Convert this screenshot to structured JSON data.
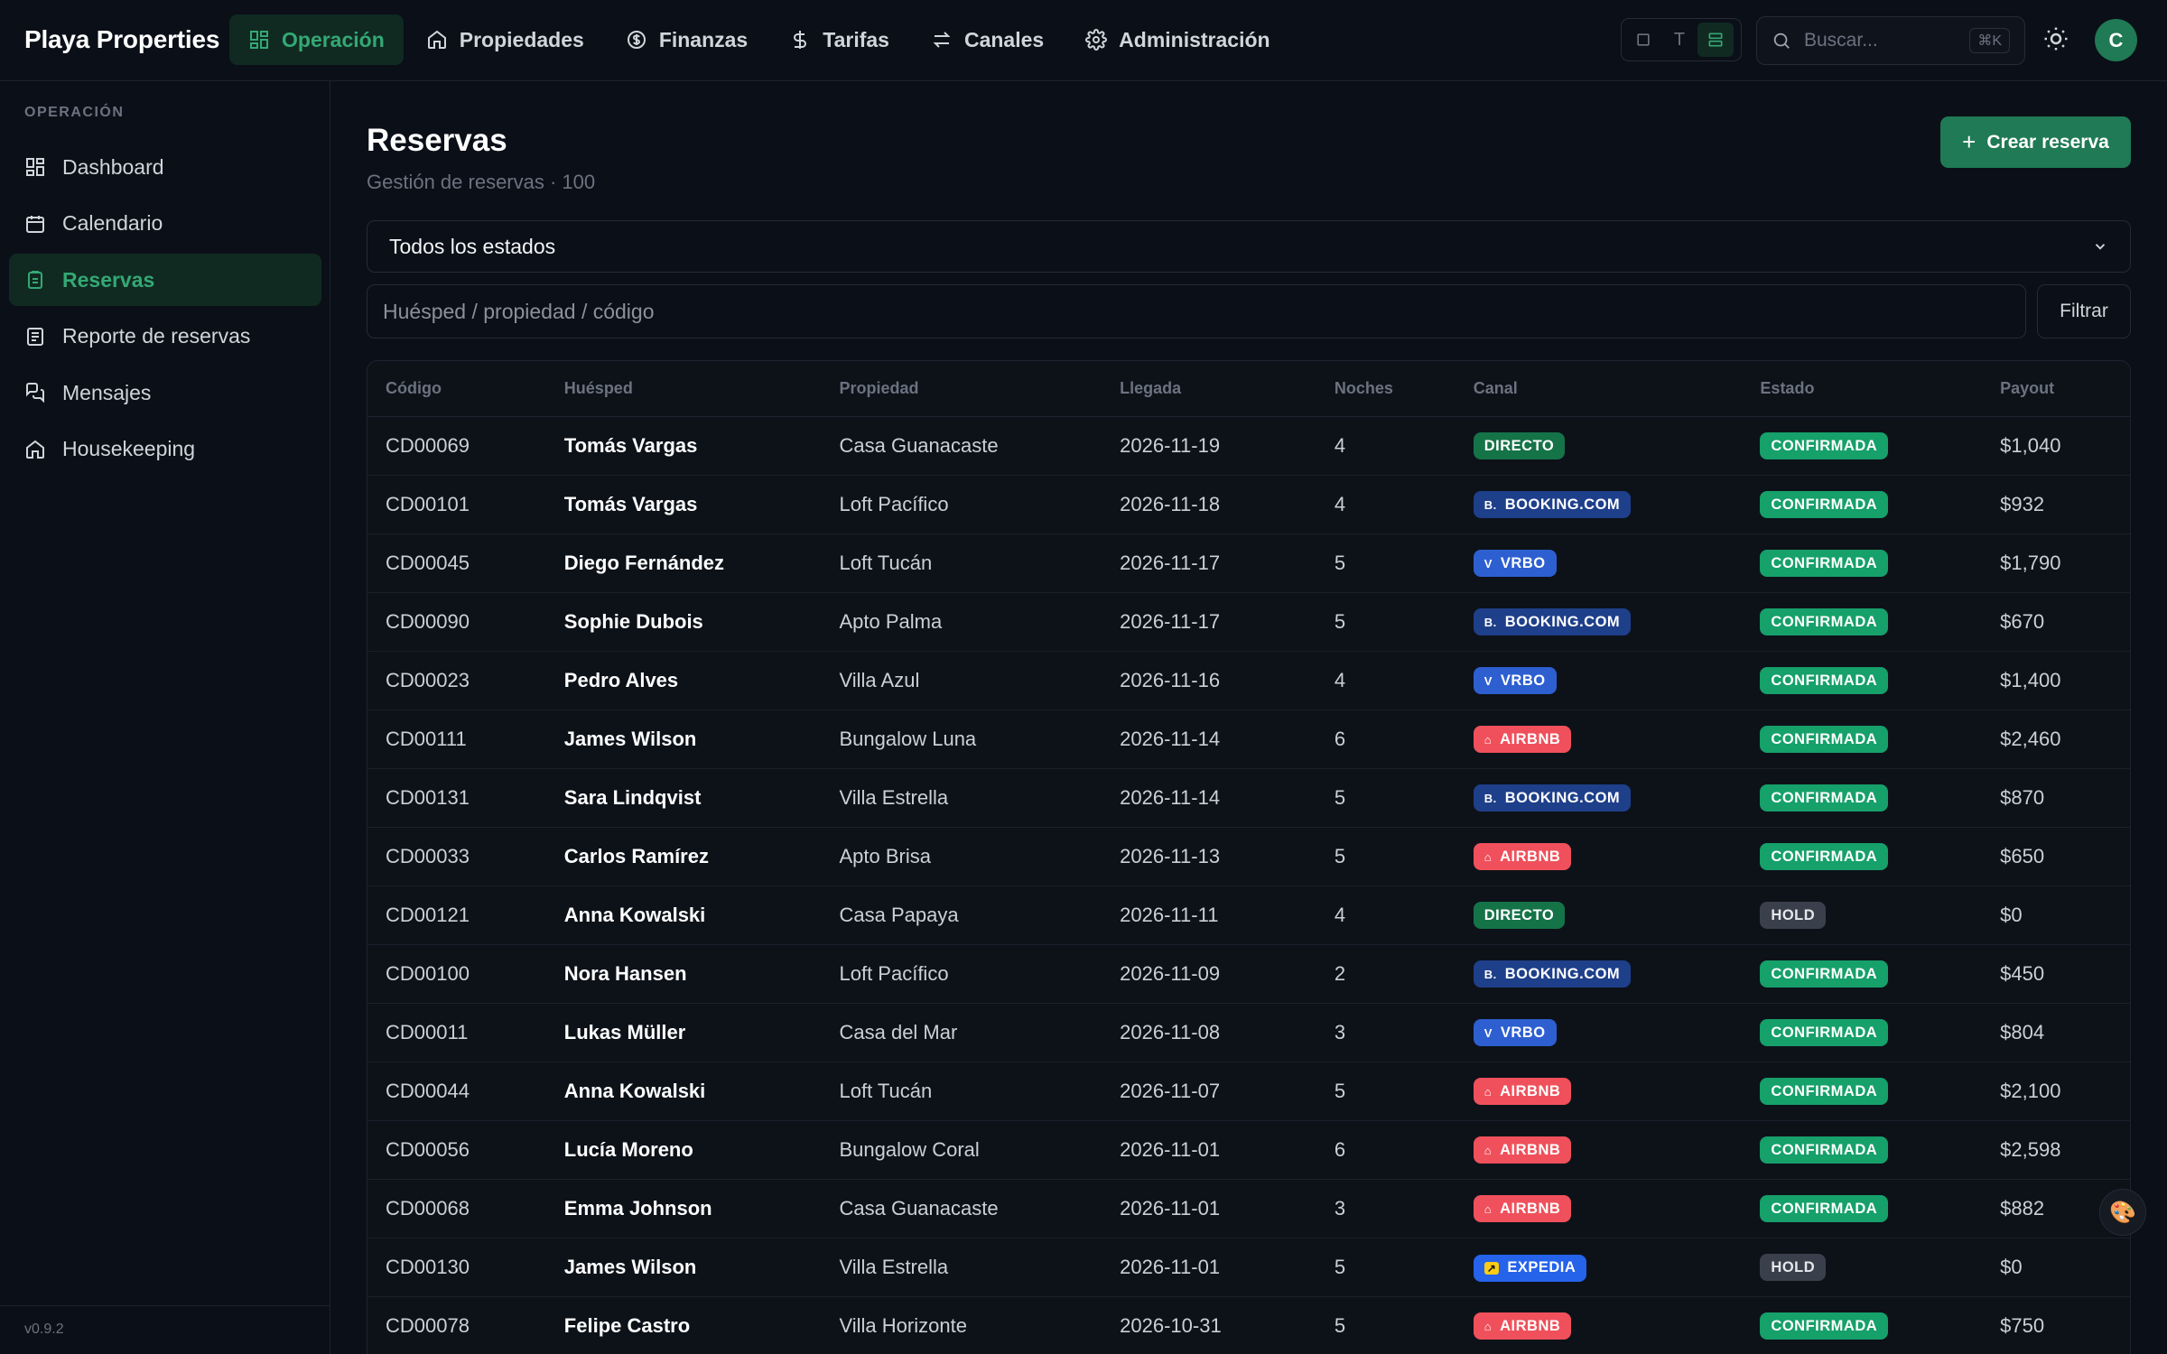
{
  "brand": "Playa Properties",
  "nav": [
    {
      "label": "Operación",
      "icon": "dashboard-icon",
      "active": true
    },
    {
      "label": "Propiedades",
      "icon": "home-icon",
      "active": false
    },
    {
      "label": "Finanzas",
      "icon": "dollar-circle-icon",
      "active": false
    },
    {
      "label": "Tarifas",
      "icon": "dollar-icon",
      "active": false
    },
    {
      "label": "Canales",
      "icon": "swap-arrows-icon",
      "active": false
    },
    {
      "label": "Administración",
      "icon": "gear-icon",
      "active": false
    }
  ],
  "view_toggle": {
    "text_label": "T"
  },
  "search": {
    "placeholder": "Buscar...",
    "shortcut": "⌘K"
  },
  "avatar": {
    "initial": "C"
  },
  "sidebar": {
    "section": "OPERACIÓN",
    "items": [
      {
        "label": "Dashboard",
        "icon": "dashboard-icon",
        "active": false
      },
      {
        "label": "Calendario",
        "icon": "calendar-icon",
        "active": false
      },
      {
        "label": "Reservas",
        "icon": "clipboard-icon",
        "active": true
      },
      {
        "label": "Reporte de reservas",
        "icon": "report-icon",
        "active": false
      },
      {
        "label": "Mensajes",
        "icon": "messages-icon",
        "active": false
      },
      {
        "label": "Housekeeping",
        "icon": "house-icon",
        "active": false
      }
    ],
    "version": "v0.9.2"
  },
  "page": {
    "title": "Reservas",
    "subtitle": "Gestión de reservas · 100",
    "create_button": "Crear reserva",
    "status_filter": "Todos los estados",
    "filter_placeholder": "Huésped / propiedad / código",
    "filter_button": "Filtrar"
  },
  "colors": {
    "accent": "#1f7a55",
    "directo": "#157348",
    "booking": "#1e3f8a",
    "vrbo": "#2d5fd1",
    "airbnb": "#f0505b",
    "expedia": "#2563eb",
    "confirmada": "#16a06a",
    "hold": "#3a404b"
  },
  "table": {
    "headers": [
      "Código",
      "Huésped",
      "Propiedad",
      "Llegada",
      "Noches",
      "Canal",
      "Estado",
      "Payout"
    ],
    "rows": [
      {
        "code": "CD00069",
        "guest": "Tomás Vargas",
        "property": "Casa Guanacaste",
        "arrival": "2026-11-19",
        "nights": "4",
        "channel": "DIRECTO",
        "status": "CONFIRMADA",
        "payout": "$1,040"
      },
      {
        "code": "CD00101",
        "guest": "Tomás Vargas",
        "property": "Loft Pacífico",
        "arrival": "2026-11-18",
        "nights": "4",
        "channel": "BOOKING.COM",
        "status": "CONFIRMADA",
        "payout": "$932"
      },
      {
        "code": "CD00045",
        "guest": "Diego Fernández",
        "property": "Loft Tucán",
        "arrival": "2026-11-17",
        "nights": "5",
        "channel": "VRBO",
        "status": "CONFIRMADA",
        "payout": "$1,790"
      },
      {
        "code": "CD00090",
        "guest": "Sophie Dubois",
        "property": "Apto Palma",
        "arrival": "2026-11-17",
        "nights": "5",
        "channel": "BOOKING.COM",
        "status": "CONFIRMADA",
        "payout": "$670"
      },
      {
        "code": "CD00023",
        "guest": "Pedro Alves",
        "property": "Villa Azul",
        "arrival": "2026-11-16",
        "nights": "4",
        "channel": "VRBO",
        "status": "CONFIRMADA",
        "payout": "$1,400"
      },
      {
        "code": "CD00111",
        "guest": "James Wilson",
        "property": "Bungalow Luna",
        "arrival": "2026-11-14",
        "nights": "6",
        "channel": "AIRBNB",
        "status": "CONFIRMADA",
        "payout": "$2,460"
      },
      {
        "code": "CD00131",
        "guest": "Sara Lindqvist",
        "property": "Villa Estrella",
        "arrival": "2026-11-14",
        "nights": "5",
        "channel": "BOOKING.COM",
        "status": "CONFIRMADA",
        "payout": "$870"
      },
      {
        "code": "CD00033",
        "guest": "Carlos Ramírez",
        "property": "Apto Brisa",
        "arrival": "2026-11-13",
        "nights": "5",
        "channel": "AIRBNB",
        "status": "CONFIRMADA",
        "payout": "$650"
      },
      {
        "code": "CD00121",
        "guest": "Anna Kowalski",
        "property": "Casa Papaya",
        "arrival": "2026-11-11",
        "nights": "4",
        "channel": "DIRECTO",
        "status": "HOLD",
        "payout": "$0"
      },
      {
        "code": "CD00100",
        "guest": "Nora Hansen",
        "property": "Loft Pacífico",
        "arrival": "2026-11-09",
        "nights": "2",
        "channel": "BOOKING.COM",
        "status": "CONFIRMADA",
        "payout": "$450"
      },
      {
        "code": "CD00011",
        "guest": "Lukas Müller",
        "property": "Casa del Mar",
        "arrival": "2026-11-08",
        "nights": "3",
        "channel": "VRBO",
        "status": "CONFIRMADA",
        "payout": "$804"
      },
      {
        "code": "CD00044",
        "guest": "Anna Kowalski",
        "property": "Loft Tucán",
        "arrival": "2026-11-07",
        "nights": "5",
        "channel": "AIRBNB",
        "status": "CONFIRMADA",
        "payout": "$2,100"
      },
      {
        "code": "CD00056",
        "guest": "Lucía Moreno",
        "property": "Bungalow Coral",
        "arrival": "2026-11-01",
        "nights": "6",
        "channel": "AIRBNB",
        "status": "CONFIRMADA",
        "payout": "$2,598"
      },
      {
        "code": "CD00068",
        "guest": "Emma Johnson",
        "property": "Casa Guanacaste",
        "arrival": "2026-11-01",
        "nights": "3",
        "channel": "AIRBNB",
        "status": "CONFIRMADA",
        "payout": "$882"
      },
      {
        "code": "CD00130",
        "guest": "James Wilson",
        "property": "Villa Estrella",
        "arrival": "2026-11-01",
        "nights": "5",
        "channel": "EXPEDIA",
        "status": "HOLD",
        "payout": "$0"
      },
      {
        "code": "CD00078",
        "guest": "Felipe Castro",
        "property": "Villa Horizonte",
        "arrival": "2026-10-31",
        "nights": "5",
        "channel": "AIRBNB",
        "status": "CONFIRMADA",
        "payout": "$750"
      }
    ]
  }
}
